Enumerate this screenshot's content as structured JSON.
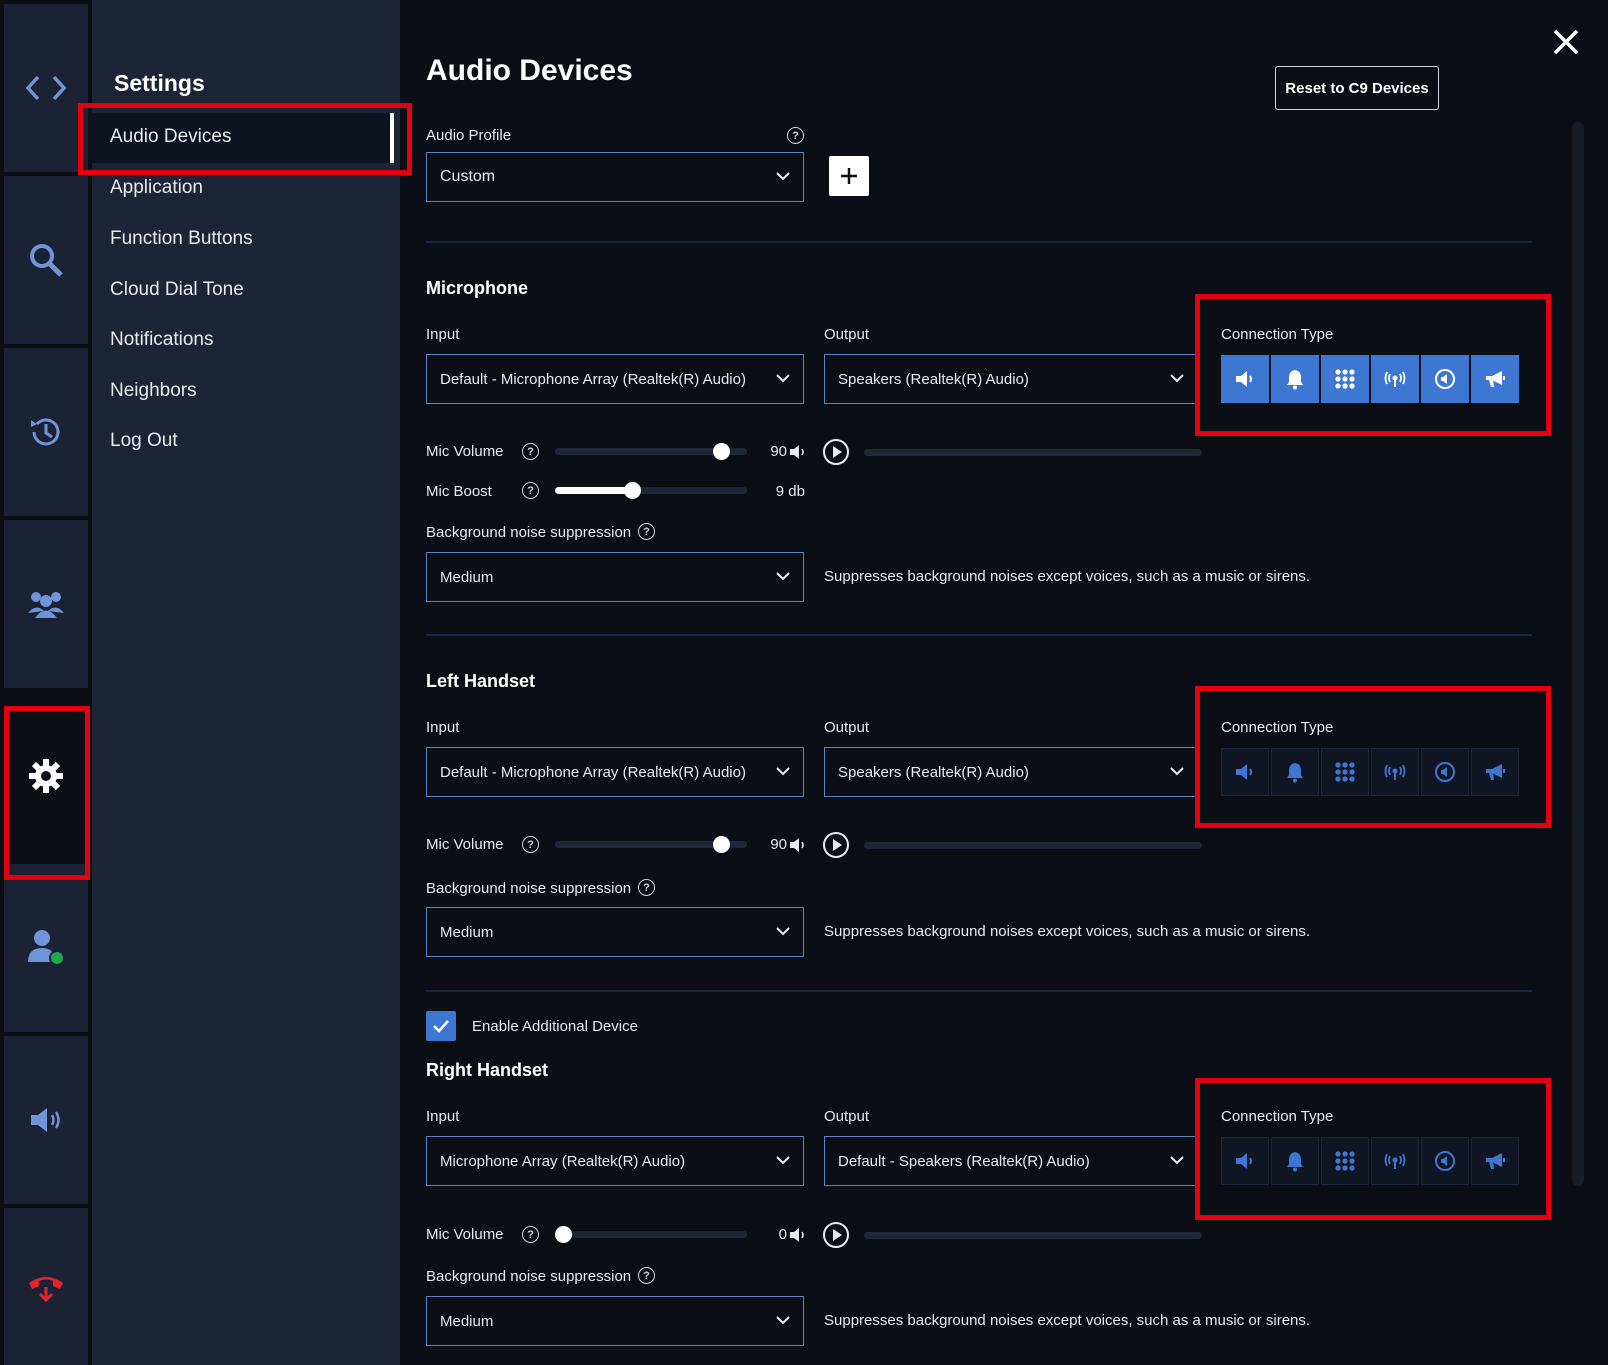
{
  "window": {
    "close_icon": "close-icon"
  },
  "rail": {
    "items": [
      {
        "icon": "code-brackets-icon"
      },
      {
        "icon": "search-icon"
      },
      {
        "icon": "history-icon"
      },
      {
        "icon": "contacts-icon"
      },
      {
        "icon": "gear-icon",
        "active": true
      },
      {
        "icon": "user-status-icon",
        "status_color": "#1faa4a"
      },
      {
        "icon": "speaker-icon"
      },
      {
        "icon": "hangup-icon",
        "color": "#e0242f"
      }
    ]
  },
  "sidebar": {
    "title": "Settings",
    "items": [
      {
        "label": "Audio Devices",
        "active": true
      },
      {
        "label": "Application"
      },
      {
        "label": "Function Buttons"
      },
      {
        "label": "Cloud Dial Tone"
      },
      {
        "label": "Notifications"
      },
      {
        "label": "Neighbors"
      },
      {
        "label": "Log Out"
      }
    ]
  },
  "main": {
    "title": "Audio Devices",
    "reset_button": "Reset to C9 Devices",
    "audio_profile": {
      "label": "Audio Profile",
      "value": "Custom"
    },
    "microphone": {
      "title": "Microphone",
      "input_label": "Input",
      "input_value": "Default - Microphone Array (Realtek(R) Audio)",
      "output_label": "Output",
      "output_value": "Speakers (Realtek(R) Audio)",
      "connection_type_label": "Connection Type",
      "connection_active": true,
      "mic_volume_label": "Mic Volume",
      "mic_volume_value": "90",
      "mic_volume_level": 0.9,
      "mic_boost_label": "Mic Boost",
      "mic_boost_value": "9 db",
      "mic_boost_level": 0.39,
      "noise_label": "Background noise suppression",
      "noise_value": "Medium",
      "noise_desc": "Suppresses background noises except voices, such as a music or sirens."
    },
    "left_handset": {
      "title": "Left Handset",
      "input_label": "Input",
      "input_value": "Default - Microphone Array (Realtek(R) Audio)",
      "output_label": "Output",
      "output_value": "Speakers (Realtek(R) Audio)",
      "connection_type_label": "Connection Type",
      "connection_active": false,
      "mic_volume_label": "Mic Volume",
      "mic_volume_value": "90",
      "mic_volume_level": 0.9,
      "noise_label": "Background noise suppression",
      "noise_value": "Medium",
      "noise_desc": "Suppresses background noises except voices, such as a music or sirens."
    },
    "additional_device": {
      "label": "Enable Additional Device",
      "checked": true
    },
    "right_handset": {
      "title": "Right Handset",
      "input_label": "Input",
      "input_value": "Microphone Array (Realtek(R) Audio)",
      "output_label": "Output",
      "output_value": "Default - Speakers (Realtek(R) Audio)",
      "connection_type_label": "Connection Type",
      "connection_active": false,
      "mic_volume_label": "Mic Volume",
      "mic_volume_value": "0",
      "mic_volume_level": 0.0,
      "noise_label": "Background noise suppression",
      "noise_value": "Medium",
      "noise_desc": "Suppresses background noises except voices, such as a music or sirens."
    },
    "connection_icons": [
      "speaker-icon",
      "bell-icon",
      "dialpad-icon",
      "broadcast-icon",
      "volume-circle-icon",
      "megaphone-icon"
    ]
  },
  "colors": {
    "accent": "#3e77d2",
    "highlight": "#e4000f",
    "sidebar": "#1c2436",
    "background": "#0b0e14"
  }
}
